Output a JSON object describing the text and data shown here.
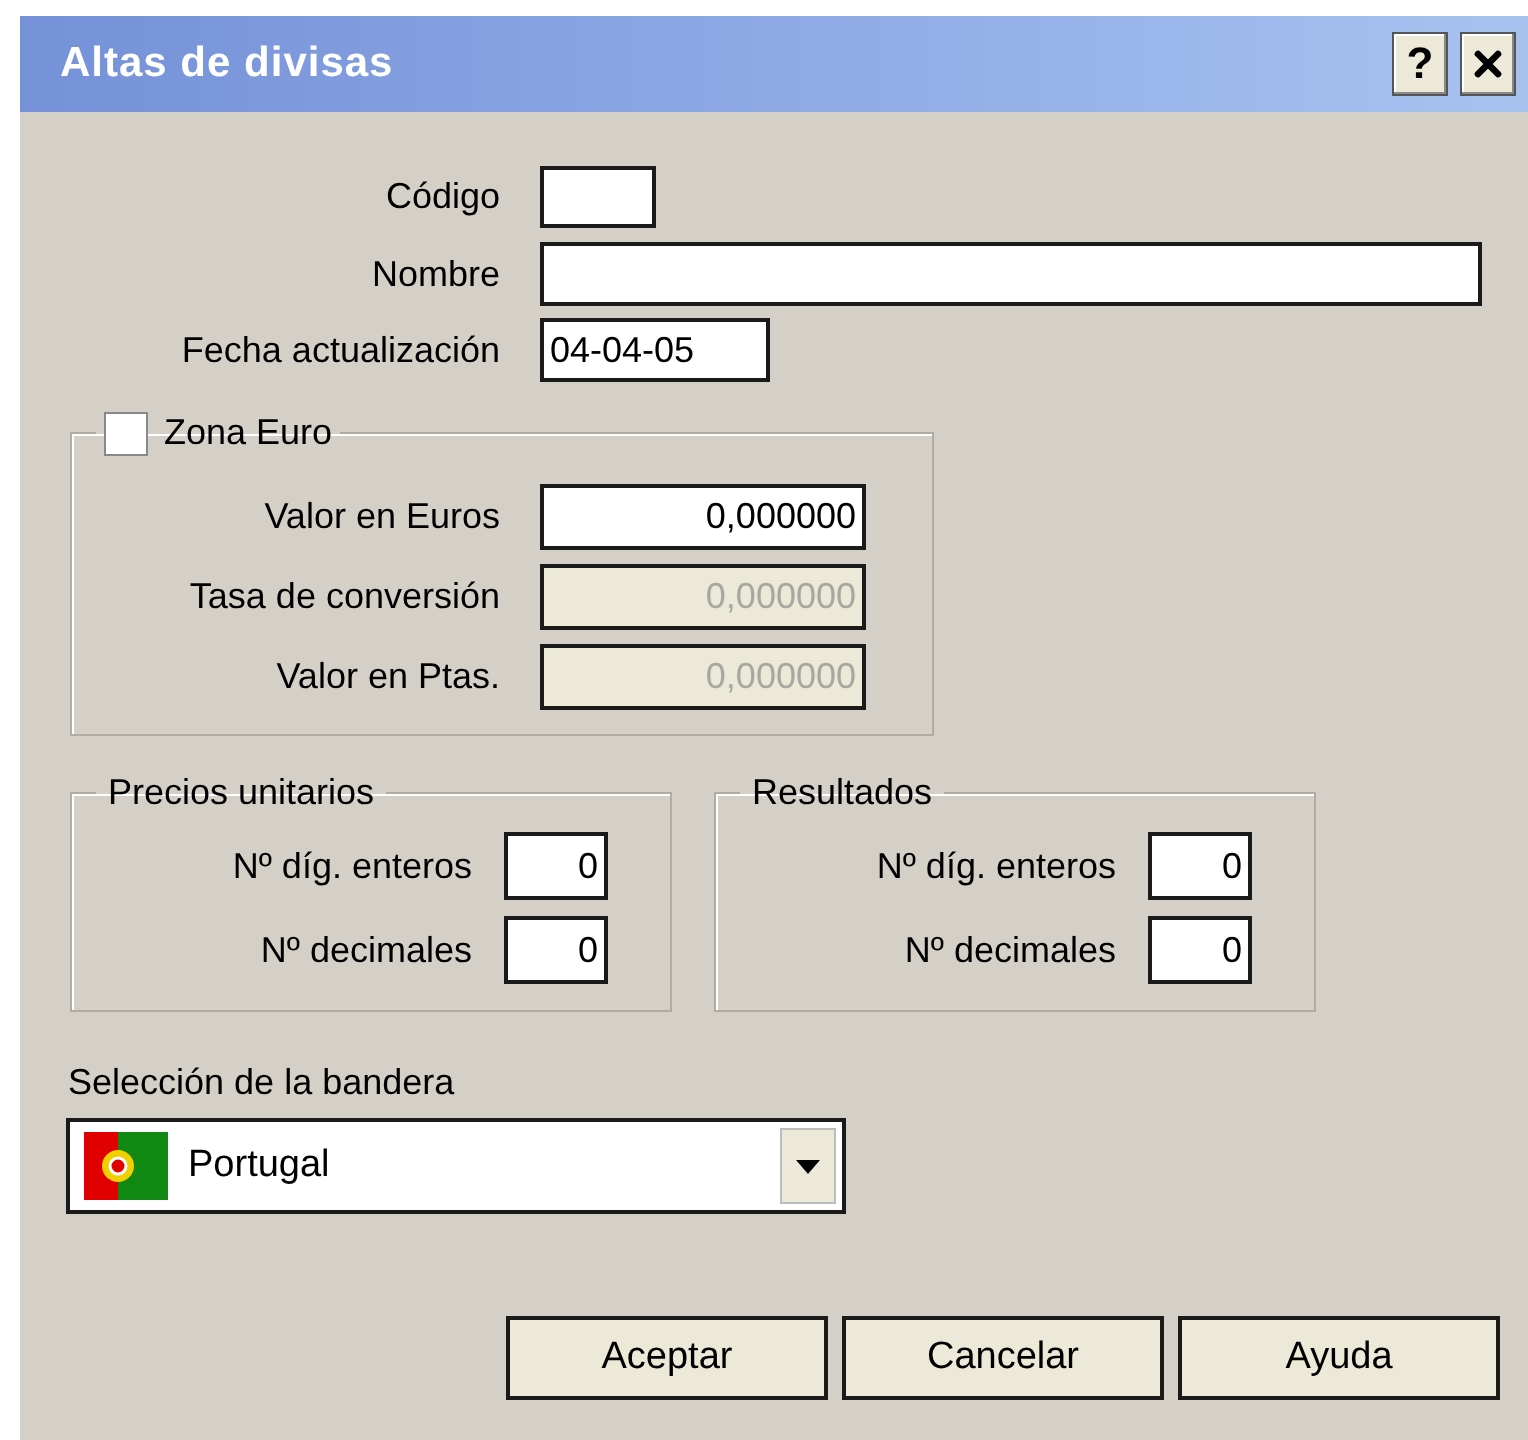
{
  "window": {
    "title": "Altas de divisas",
    "help_button": "?"
  },
  "fields": [
    {
      "label": "Código"
    },
    {
      "label": "Nombre"
    },
    {
      "label": "Fecha actualización",
      "value": "04-04-05"
    }
  ],
  "zona_euro": {
    "label": "Zona Euro",
    "checked": false,
    "fields": [
      {
        "label": "Valor en Euros",
        "value": "0,000000",
        "disabled": false
      },
      {
        "label": "Tasa de conversión",
        "value": "0,000000",
        "disabled": true
      },
      {
        "label": "Valor en Ptas.",
        "value": "0,000000",
        "disabled": true
      }
    ]
  },
  "precios_unitarios": {
    "title": "Precios unitarios",
    "fields": [
      {
        "label": "Nº díg. enteros",
        "value": "0"
      },
      {
        "label": "Nº decimales",
        "value": "0"
      }
    ]
  },
  "resultados": {
    "title": "Resultados",
    "fields": [
      {
        "label": "Nº díg. enteros",
        "value": "0"
      },
      {
        "label": "Nº decimales",
        "value": "0"
      }
    ]
  },
  "flag_selection": {
    "label": "Selección de la bandera",
    "value": "Portugal"
  },
  "buttons": [
    "Aceptar",
    "Cancelar",
    "Ayuda"
  ]
}
